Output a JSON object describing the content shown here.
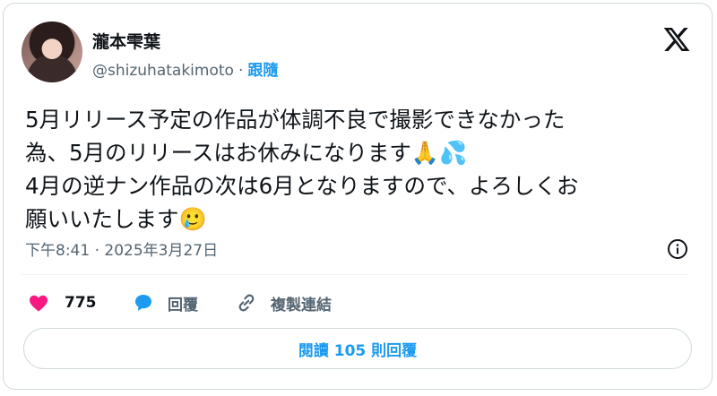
{
  "author": {
    "name": "瀧本雫葉",
    "handle": "@shizuhatakimoto",
    "separator": "·",
    "follow_label": "跟隨"
  },
  "platform_logo": "x-logo-icon",
  "tweet": {
    "line1": "5月リリース予定の作品が体調不良で撮影できなかった",
    "line2": "為、5月のリリースはお休みになります",
    "line2_emojis": "🙏💦",
    "line3": "4月の逆ナン作品の次は6月となりますので、よろしくお",
    "line4": "願いいたします",
    "line4_emoji": "🥲"
  },
  "meta": {
    "time": "下午8:41",
    "separator": "·",
    "date": "2025年3月27日"
  },
  "actions": {
    "like_count": "775",
    "reply_label": "回覆",
    "copy_link_label": "複製連結"
  },
  "read_replies_label": "閱讀 105 則回覆",
  "colors": {
    "accent": "#1d9bf0",
    "like": "#f91880",
    "text": "#0f1419",
    "secondary": "#536471"
  }
}
